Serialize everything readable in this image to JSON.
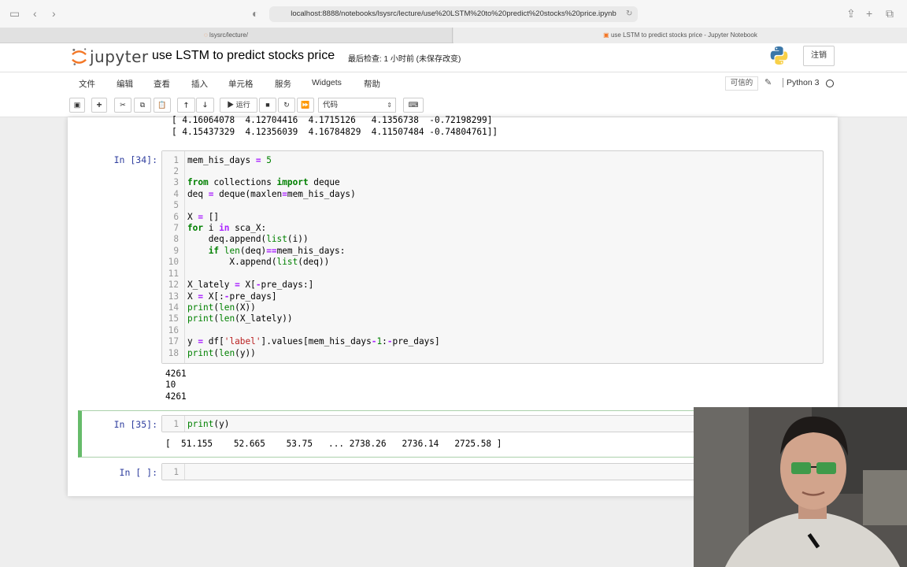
{
  "browser": {
    "url": "localhost:8888/notebooks/lsysrc/lecture/use%20LSTM%20to%20predict%20stocks%20price.ipynb",
    "tabs": [
      {
        "label": "lsysrc/lecture/"
      },
      {
        "label": "use LSTM to predict stocks price - Jupyter Notebook"
      }
    ]
  },
  "header": {
    "logo_text": "jupyter",
    "notebook_title": "use LSTM to predict stocks price",
    "checkpoint": "最后检查: 1 小时前  (未保存改变)",
    "logout_label": "注销"
  },
  "menubar": {
    "items": [
      "文件",
      "编辑",
      "查看",
      "插入",
      "单元格",
      "服务",
      "Widgets",
      "帮助"
    ],
    "trusted": "可信的",
    "kernel": "Python 3"
  },
  "toolbar": {
    "run_label": "运行",
    "cell_type": "代码"
  },
  "cells": {
    "prev_output": [
      "[ 4.16064078  4.12704416  4.1715126   4.1356738  -0.72198299]",
      "[ 4.15437329  4.12356039  4.16784829  4.11507484 -0.74804761]]"
    ],
    "cell34": {
      "prompt": "In [34]:",
      "line_numbers": [
        "1",
        "2",
        "3",
        "4",
        "5",
        "6",
        "7",
        "8",
        "9",
        "10",
        "11",
        "12",
        "13",
        "14",
        "15",
        "16",
        "17",
        "18"
      ],
      "output": [
        "4261",
        "10",
        "4261"
      ]
    },
    "cell35": {
      "prompt": "In [35]:",
      "line_numbers": [
        "1"
      ],
      "output": "[  51.155    52.665    53.75   ... 2738.26   2736.14   2725.58 ]"
    },
    "cell_empty": {
      "prompt": "In [ ]:",
      "line_numbers": [
        "1"
      ]
    }
  },
  "colors": {
    "prompt_in": "#303f9f",
    "keyword": "#008000",
    "operator": "#aa22ff",
    "string": "#ba2121",
    "selected_cell_border": "#66bb6a"
  }
}
